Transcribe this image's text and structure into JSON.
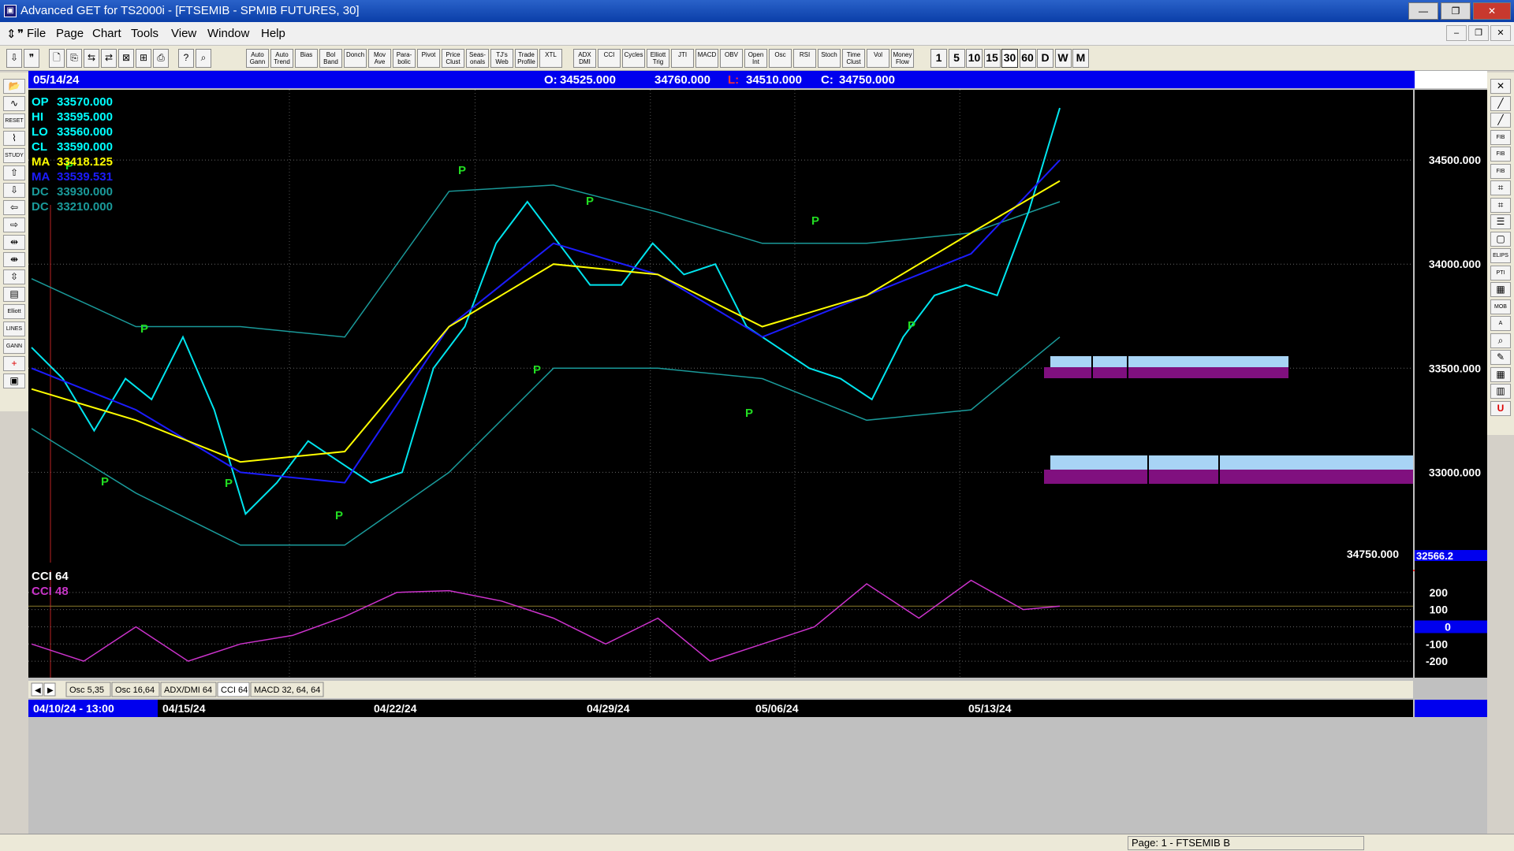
{
  "window": {
    "title": "Advanced GET for TS2000i - [FTSEMIB - SPMIB FUTURES, 30]",
    "buttons": {
      "minimize": "—",
      "maximize": "❐",
      "close": "✕"
    }
  },
  "menu": [
    "File",
    "Page",
    "Chart",
    "Tools",
    "View",
    "Window",
    "Help"
  ],
  "toolbar": {
    "study_buttons": [
      "Auto Gann",
      "Auto Trend",
      "Bias",
      "Bol Band",
      "Donch",
      "Mov Ave",
      "Para-bolic",
      "Pivot",
      "Price Clust",
      "Seas-onals",
      "TJ's Web",
      "Trade Profile",
      "XTL",
      "ADX DMI",
      "CCI",
      "Cycles",
      "Elliott Trig",
      "JTI",
      "MACD",
      "OBV",
      "Open Int",
      "Osc",
      "RSI",
      "Stoch",
      "Time Clust",
      "Vol",
      "Money Flow"
    ],
    "intervals": [
      "1",
      "5",
      "10",
      "15",
      "30",
      "60",
      "D",
      "W",
      "M"
    ],
    "selected_interval": "30"
  },
  "left_tools": [
    "RESET",
    "STUDY",
    "Elliott",
    "LINES",
    "GANN",
    "FIB"
  ],
  "right_tools": [
    "FIB RET",
    "FIB EXT",
    "FIB TIME",
    "ELIPS",
    "PTI",
    "MOB",
    "A"
  ],
  "header": {
    "date": "05/14/24",
    "open_label": "O:",
    "open": "34525.000",
    "high": "34760.000",
    "low_label": "L:",
    "low": "34510.000",
    "close_label": "C:",
    "close": "34750.000"
  },
  "legend": [
    {
      "label": "OP",
      "value": "33570.000",
      "color": "#00ffff"
    },
    {
      "label": "HI",
      "value": "33595.000",
      "color": "#00ffff"
    },
    {
      "label": "LO",
      "value": "33560.000",
      "color": "#00ffff"
    },
    {
      "label": "CL",
      "value": "33590.000",
      "color": "#00ffff"
    },
    {
      "label": "MA",
      "value": "33418.125",
      "color": "#ffff00"
    },
    {
      "label": "MA",
      "value": "33539.531",
      "color": "#1c1cff"
    },
    {
      "label": "DC",
      "value": "33930.000",
      "color": "#1a9a9a"
    },
    {
      "label": "DC",
      "value": "33210.000",
      "color": "#1a9a9a"
    }
  ],
  "price_axis": {
    "ticks": [
      "34500.000",
      "34000.000",
      "33500.000",
      "33000.000"
    ],
    "last_price": "34750.000",
    "cut_label": "32566.2"
  },
  "cci": {
    "labels": [
      "CCI 64",
      "CCI  48"
    ],
    "ticks": [
      "200",
      "100",
      "0",
      "-100",
      "-200"
    ],
    "zero_label": "0"
  },
  "tabs": [
    "Osc 5,35",
    "Osc 16,64",
    "ADX/DMI 64",
    "CCI 64",
    "MACD 32, 64, 64"
  ],
  "time_axis": {
    "first": "04/10/24 - 13:00",
    "labels": [
      "04/15/24",
      "04/22/24",
      "04/29/24",
      "05/06/24",
      "05/13/24"
    ]
  },
  "pivot_label": "P",
  "status": "Page: 1 - FTSEMIB B",
  "colors": {
    "price": "#00e5ee",
    "ma_fast": "#ffff00",
    "ma_slow": "#1c1cff",
    "donchian": "#1a9a9a",
    "cci": "#cc33cc",
    "pivot": "#22dd22",
    "header_bg": "#0000ee"
  },
  "chart_data": {
    "type": "line",
    "series": [
      {
        "name": "CL",
        "x": [
          0,
          6,
          12,
          18,
          23,
          29,
          35,
          41,
          47,
          53,
          59,
          65,
          71,
          77,
          83,
          89,
          95,
          101,
          107,
          113,
          119,
          125,
          131,
          137,
          143,
          149,
          155,
          161,
          167,
          173,
          179,
          185,
          191,
          197
        ],
        "values": [
          33600,
          33450,
          33200,
          33450,
          33350,
          33650,
          33300,
          32800,
          32950,
          33150,
          33050,
          32950,
          33000,
          33500,
          33700,
          34100,
          34300,
          34100,
          33900,
          33900,
          34100,
          33950,
          34000,
          33700,
          33600,
          33500,
          33450,
          33350,
          33650,
          33850,
          33900,
          33850,
          34250,
          34750
        ]
      },
      {
        "name": "MA",
        "x": [
          0,
          20,
          40,
          60,
          80,
          100,
          120,
          140,
          160,
          180,
          197
        ],
        "values": [
          33400,
          33250,
          33050,
          33100,
          33700,
          34000,
          33950,
          33700,
          33850,
          34150,
          34400
        ]
      },
      {
        "name": "MA",
        "x": [
          0,
          20,
          40,
          60,
          80,
          100,
          120,
          140,
          160,
          180,
          197
        ],
        "values": [
          33500,
          33300,
          33000,
          32950,
          33700,
          34100,
          33950,
          33650,
          33850,
          34050,
          34500
        ]
      },
      {
        "name": "DC",
        "x": [
          0,
          20,
          40,
          60,
          80,
          100,
          120,
          140,
          160,
          180,
          197
        ],
        "values": [
          33930,
          33700,
          33700,
          33650,
          34350,
          34380,
          34250,
          34100,
          34100,
          34150,
          34300
        ]
      },
      {
        "name": "DC",
        "x": [
          0,
          20,
          40,
          60,
          80,
          100,
          120,
          140,
          160,
          180,
          197
        ],
        "values": [
          33210,
          32900,
          32650,
          32650,
          33000,
          33500,
          33500,
          33450,
          33250,
          33300,
          33650
        ]
      },
      {
        "name": "CCI 64",
        "x": [
          0,
          10,
          20,
          30,
          40,
          50,
          60,
          70,
          80,
          90,
          100,
          110,
          120,
          130,
          140,
          150,
          160,
          170,
          180,
          190,
          197
        ],
        "values": [
          -100,
          -200,
          0,
          -200,
          -100,
          -50,
          60,
          200,
          210,
          150,
          50,
          -100,
          50,
          -200,
          -100,
          0,
          250,
          50,
          270,
          100,
          120
        ]
      }
    ],
    "xlim": [
      0,
      197
    ],
    "ylim": [
      32566,
      34830
    ],
    "cci_ylim": [
      -250,
      300
    ]
  }
}
